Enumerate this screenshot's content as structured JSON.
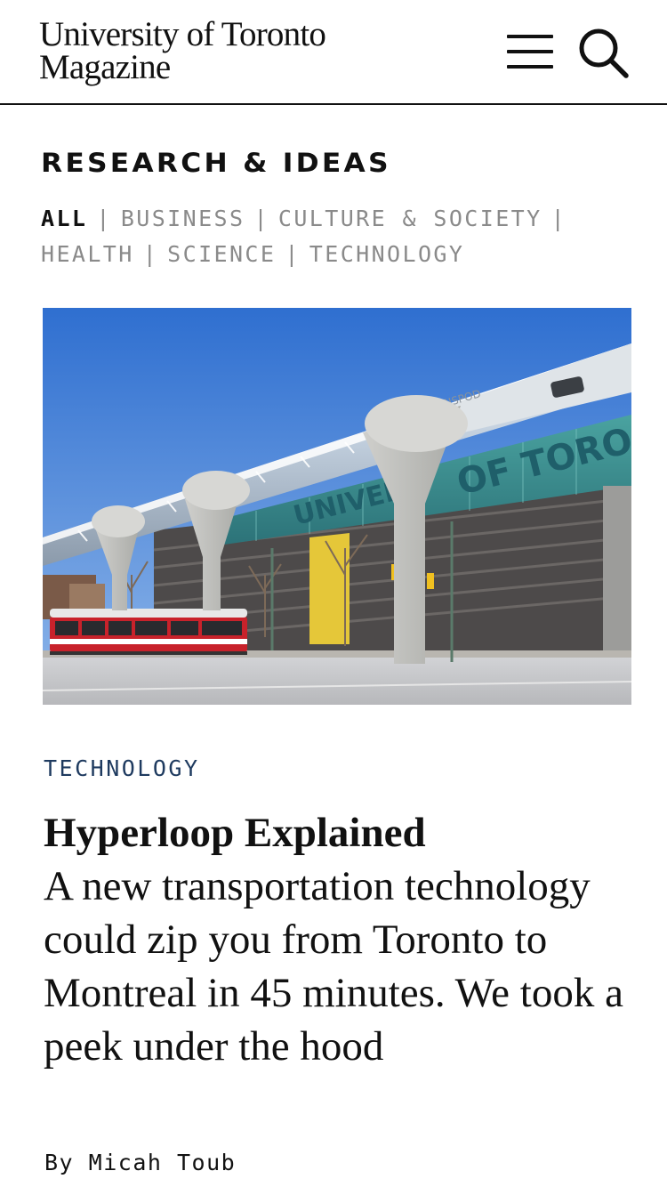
{
  "header": {
    "logo_line1": "University of Toronto",
    "logo_line2": "Magazine",
    "menu_icon": "hamburger-menu-icon",
    "search_icon": "search-icon"
  },
  "section": {
    "title": "RESEARCH & IDEAS",
    "filters": [
      {
        "label": "ALL",
        "active": true
      },
      {
        "label": "BUSINESS",
        "active": false
      },
      {
        "label": "CULTURE & SOCIETY",
        "active": false
      },
      {
        "label": "HEALTH",
        "active": false
      },
      {
        "label": "SCIENCE",
        "active": false
      },
      {
        "label": "TECHNOLOGY",
        "active": false
      }
    ],
    "separator": "|"
  },
  "article": {
    "category": "TECHNOLOGY",
    "title": "Hyperloop Explained",
    "dek": "A new transportation technology could zip you from Toronto to Montreal in 45 minutes. We took a peek under the hood",
    "byline_prefix": "By",
    "author": "Micah Toub",
    "hero": {
      "tube_text": "TRANSPOD",
      "building_text_left": "UNIVER",
      "building_text_right": "OF TORO"
    }
  },
  "colors": {
    "category_blue": "#1e3a5f",
    "sky": "#3d7cd6",
    "streetcar_red": "#c8222b",
    "inactive_filter": "#8a8a8a"
  }
}
